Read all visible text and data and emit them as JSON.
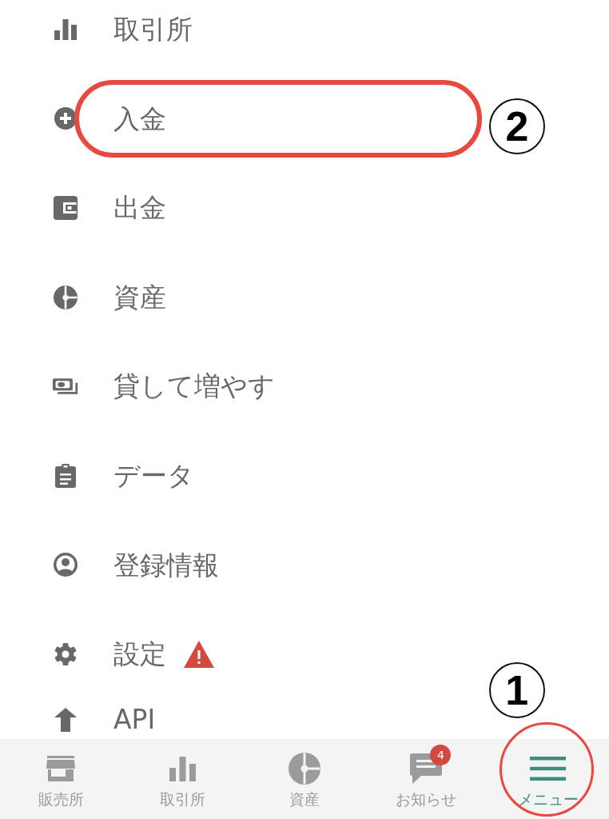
{
  "menu": {
    "items": [
      {
        "label": "取引所",
        "highlighted": false,
        "warning": false
      },
      {
        "label": "入金",
        "highlighted": true,
        "warning": false,
        "callout": "2"
      },
      {
        "label": "出金",
        "highlighted": false,
        "warning": false
      },
      {
        "label": "資産",
        "highlighted": false,
        "warning": false
      },
      {
        "label": "貸して増やす",
        "highlighted": false,
        "warning": false
      },
      {
        "label": "データ",
        "highlighted": false,
        "warning": false
      },
      {
        "label": "登録情報",
        "highlighted": false,
        "warning": false
      },
      {
        "label": "設定",
        "highlighted": false,
        "warning": true
      },
      {
        "label": "API",
        "highlighted": false,
        "warning": false
      }
    ]
  },
  "bottom_nav": {
    "tabs": [
      {
        "label": "販売所",
        "selected": false,
        "highlighted": false
      },
      {
        "label": "取引所",
        "selected": false,
        "highlighted": false
      },
      {
        "label": "資産",
        "selected": false,
        "highlighted": false
      },
      {
        "label": "お知らせ",
        "selected": false,
        "highlighted": false,
        "badge": "4"
      },
      {
        "label": "メニュー",
        "selected": true,
        "highlighted": true,
        "callout": "1"
      }
    ]
  }
}
